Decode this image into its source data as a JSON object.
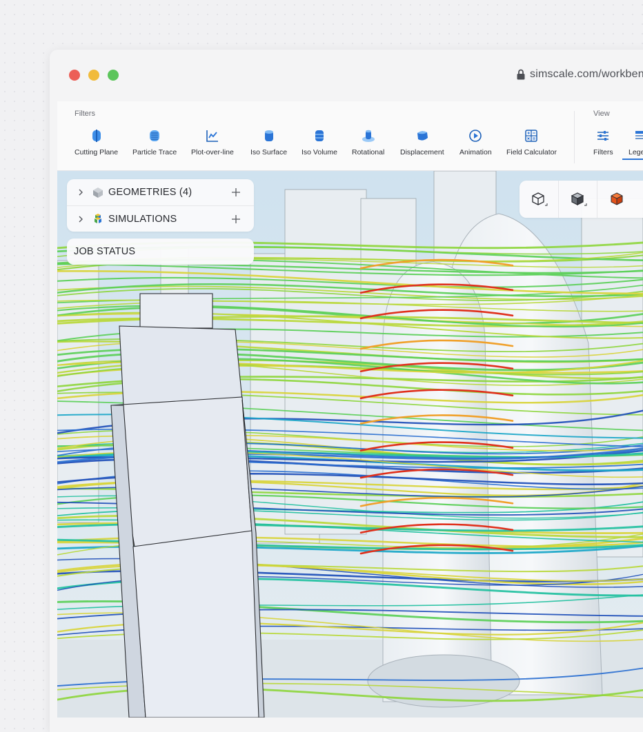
{
  "window": {
    "url": "simscale.com/workbench",
    "controls": [
      "close",
      "minimize",
      "maximize"
    ]
  },
  "toolbar": {
    "filters_label": "Filters",
    "view_label": "View",
    "filters": [
      {
        "label": "Cutting Plane",
        "icon": "cutting-plane-icon"
      },
      {
        "label": "Particle Trace",
        "icon": "particle-trace-icon"
      },
      {
        "label": "Plot-over-line",
        "icon": "plot-over-line-icon"
      },
      {
        "label": "Iso Surface",
        "icon": "iso-surface-icon"
      },
      {
        "label": "Iso Volume",
        "icon": "iso-volume-icon"
      },
      {
        "label": "Rotational",
        "icon": "rotational-icon"
      },
      {
        "label": "Displacement",
        "icon": "displacement-icon"
      },
      {
        "label": "Animation",
        "icon": "animation-icon"
      },
      {
        "label": "Field Calculator",
        "icon": "field-calculator-icon"
      }
    ],
    "view": [
      {
        "label": "Filters",
        "icon": "filters-sliders-icon"
      },
      {
        "label": "Legend",
        "icon": "legend-icon",
        "active": true
      }
    ]
  },
  "tree": {
    "geometries_label": "GEOMETRIES",
    "geometries_count": "(4)",
    "simulations_label": "SIMULATIONS",
    "job_status_label": "JOB STATUS"
  },
  "viewcube": {
    "buttons": [
      "wireframe-cube-icon",
      "solid-cube-icon",
      "highlighted-cube-icon"
    ]
  },
  "colors": {
    "accent": "#2a74d6",
    "streamline_low": "#1f4fb8",
    "streamline_mid": "#7cd34a",
    "streamline_high": "#e0301c"
  }
}
